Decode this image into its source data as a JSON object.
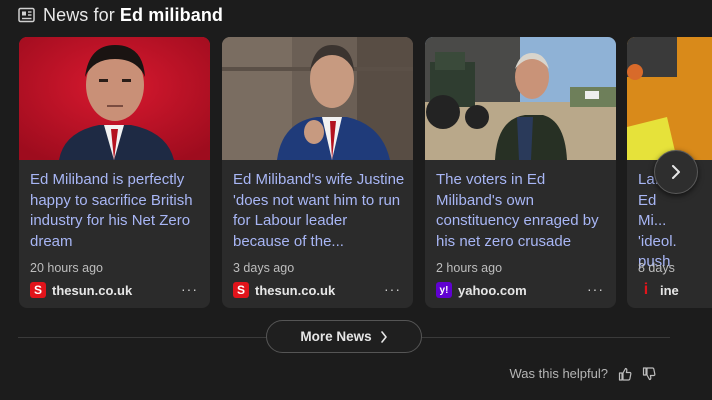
{
  "header": {
    "prefix": "News for ",
    "query": "Ed miliband"
  },
  "cards": [
    {
      "headline": "Ed Miliband is perfectly happy to sacrifice British industry for his Net Zero dream",
      "time": "20 hours ago",
      "source": "thesun.co.uk",
      "favicon_letter": "S",
      "favicon_color": "#e1141b"
    },
    {
      "headline": "Ed Miliband's wife Justine 'does not want him to run for Labour leader because of the...",
      "time": "3 days ago",
      "source": "thesun.co.uk",
      "favicon_letter": "S",
      "favicon_color": "#e1141b"
    },
    {
      "headline": "The voters in Ed Miliband's own constituency enraged by his net zero crusade",
      "time": "2 hours ago",
      "source": "yahoo.com",
      "favicon_letter": "y!",
      "favicon_color": "#6001d2"
    },
    {
      "headline": "La... Ed Mi... 'ideol... push",
      "time": "8 days",
      "source": "ine",
      "favicon_letter": "i",
      "favicon_color": "#e1141b"
    }
  ],
  "more_news_label": "More News",
  "feedback_label": "Was this helpful?",
  "colors": {
    "headline": "#a8b6f5",
    "card_bg": "#2b2b2b",
    "page_bg": "#1c1c1c"
  }
}
